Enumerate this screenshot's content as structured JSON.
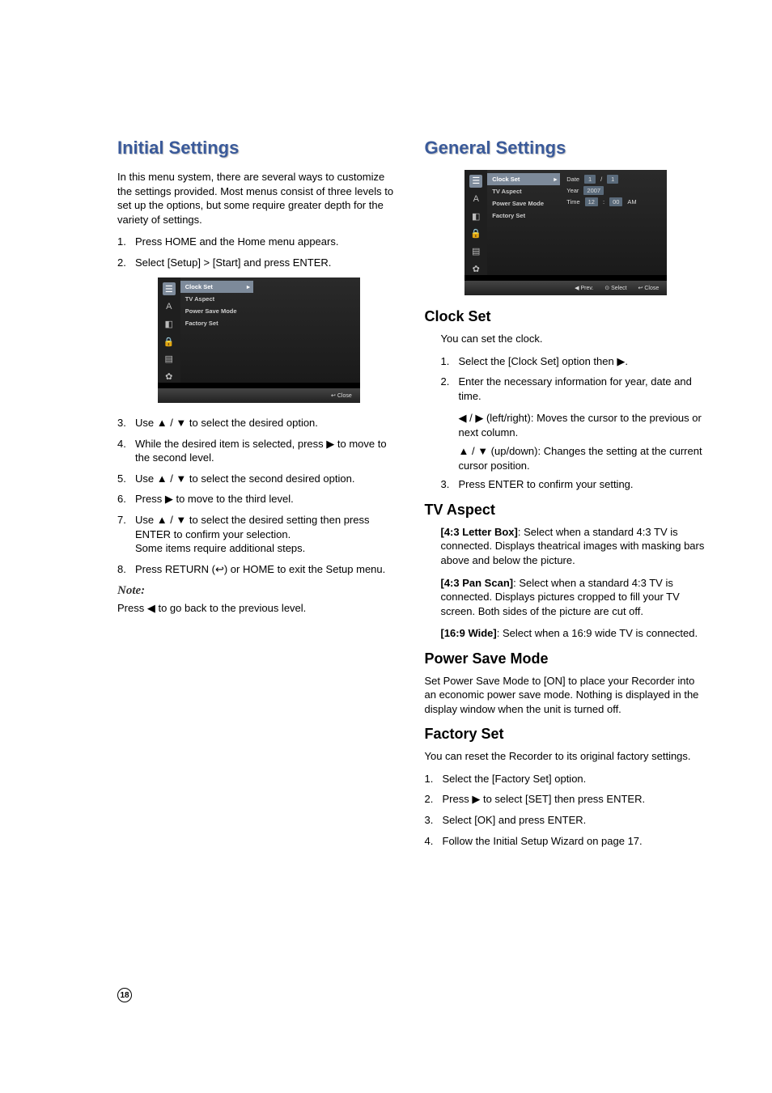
{
  "page_number": "18",
  "left": {
    "title": "Initial Settings",
    "intro": "In this menu system, there are several ways to customize the settings provided. Most menus consist of three levels to set up the options, but some require greater depth for the variety of settings.",
    "steps_a": [
      "Press HOME and the Home menu appears.",
      "Select [Setup] > [Start] and press ENTER."
    ],
    "steps_b": [
      "Use ▲ / ▼ to select the desired option.",
      "While the desired item is selected, press ▶ to move to the second level.",
      "Use ▲ / ▼ to select the second desired option.",
      "Press ▶ to move to the third level.",
      "Use ▲ / ▼ to select the desired setting then press ENTER to confirm your selection.\nSome items require additional steps.",
      "Press RETURN (↩) or HOME to exit the Setup menu."
    ],
    "note_label": "Note:",
    "note_text": "Press ◀ to go back to the previous level.",
    "osd": {
      "menu": [
        "Clock Set",
        "TV Aspect",
        "Power Save Mode",
        "Factory Set"
      ],
      "footer": [
        "↩ Close"
      ]
    }
  },
  "right": {
    "title": "General Settings",
    "osd": {
      "menu": [
        "Clock Set",
        "TV Aspect",
        "Power Save Mode",
        "Factory Set"
      ],
      "date_label": "Date",
      "date_m": "1",
      "date_d": "1",
      "year_label": "Year",
      "year": "2007",
      "time_label": "Time",
      "time_h": "12",
      "time_m": "00",
      "time_ampm": "AM",
      "footer": [
        "◀ Prev.",
        "⊙ Select",
        "↩ Close"
      ]
    },
    "clock_set": {
      "heading": "Clock Set",
      "intro": "You can set the clock.",
      "steps": [
        "Select the [Clock Set] option then ▶.",
        "Enter the necessary information for year, date and time."
      ],
      "sub1": "◀ / ▶ (left/right): Moves the cursor to the previous or next column.",
      "sub2": "▲ / ▼ (up/down): Changes the setting at the current cursor position.",
      "step3": "Press ENTER to confirm your setting."
    },
    "tv_aspect": {
      "heading": "TV Aspect",
      "opt1_label": "[4:3 Letter Box]",
      "opt1_text": ": Select when a standard 4:3 TV is connected. Displays theatrical images with masking bars above and below the picture.",
      "opt2_label": "[4:3 Pan Scan]",
      "opt2_text": ": Select when a standard 4:3 TV is connected. Displays pictures cropped to fill your TV screen. Both sides of the picture are cut off.",
      "opt3_label": "[16:9 Wide]",
      "opt3_text": ": Select when a 16:9 wide TV is connected."
    },
    "power_save": {
      "heading": "Power Save Mode",
      "text": "Set Power Save Mode to [ON] to place your Recorder into an economic power save mode. Nothing is displayed in the display window when the unit is turned off."
    },
    "factory_set": {
      "heading": "Factory Set",
      "intro": "You can reset the Recorder to its original factory settings.",
      "steps": [
        "Select the [Factory Set] option.",
        "Press ▶ to select [SET] then press ENTER.",
        "Select [OK] and press ENTER.",
        "Follow the Initial Setup Wizard on page 17."
      ]
    }
  }
}
